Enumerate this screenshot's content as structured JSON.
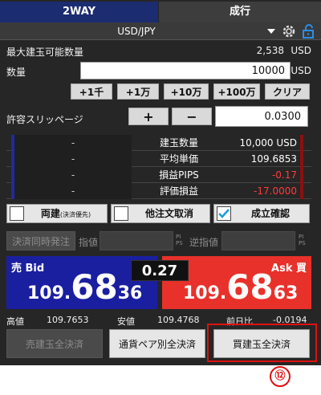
{
  "tabs": {
    "two_way": "2WAY",
    "market": "成行"
  },
  "symbol": "USD/JPY",
  "max_qty": {
    "label": "最大建玉可能数量",
    "value": "2,538",
    "unit": "USD"
  },
  "quantity": {
    "label": "数量",
    "value": "10000",
    "unit": "USD"
  },
  "increments": [
    "+1千",
    "+1万",
    "+10万",
    "+100万"
  ],
  "clear_label": "クリア",
  "slippage": {
    "label": "許容スリッページ",
    "plus": "+",
    "minus": "−",
    "value": "0.0300"
  },
  "stats": [
    {
      "left": "-",
      "label": "建玉数量",
      "value": "10,000 USD",
      "color": "#ffffff"
    },
    {
      "left": "-",
      "label": "平均単価",
      "value": "109.6853",
      "color": "#ffffff"
    },
    {
      "left": "-",
      "label": "損益PIPS",
      "value": "-0.17",
      "color": "#ff3b3b"
    },
    {
      "left": "-",
      "label": "評価損益",
      "value": "-17.0000",
      "color": "#ff3b3b"
    }
  ],
  "options": {
    "both_label": "両建",
    "both_note": "(決済優先)",
    "cancel_other": "他注文取消",
    "confirm": "成立確認"
  },
  "settle_row": {
    "simul": "決済同時発注",
    "limit": "指値",
    "stop": "逆指値",
    "pips_top": "PI",
    "pips_bottom": "PS"
  },
  "bid": {
    "label": "売 Bid",
    "small": "109.",
    "big": "68",
    "tail": "36"
  },
  "ask": {
    "label": "Ask 買",
    "small": "109.",
    "big": "68",
    "tail": "63"
  },
  "spread": "0.27",
  "high": {
    "label": "高値",
    "value": "109.7653"
  },
  "low": {
    "label": "安値",
    "value": "109.4768"
  },
  "change": {
    "label": "前日比",
    "value": "-0.0194"
  },
  "bottom": {
    "sell_all": "売建玉全決済",
    "pair_all": "通貨ペア別全決済",
    "buy_all": "買建玉全決済"
  },
  "callout": "⑫",
  "colors": {
    "bid": "#1a1fa0",
    "ask": "#e8312a",
    "highlight": "#e01010",
    "tab_active": "#1c2c70"
  }
}
